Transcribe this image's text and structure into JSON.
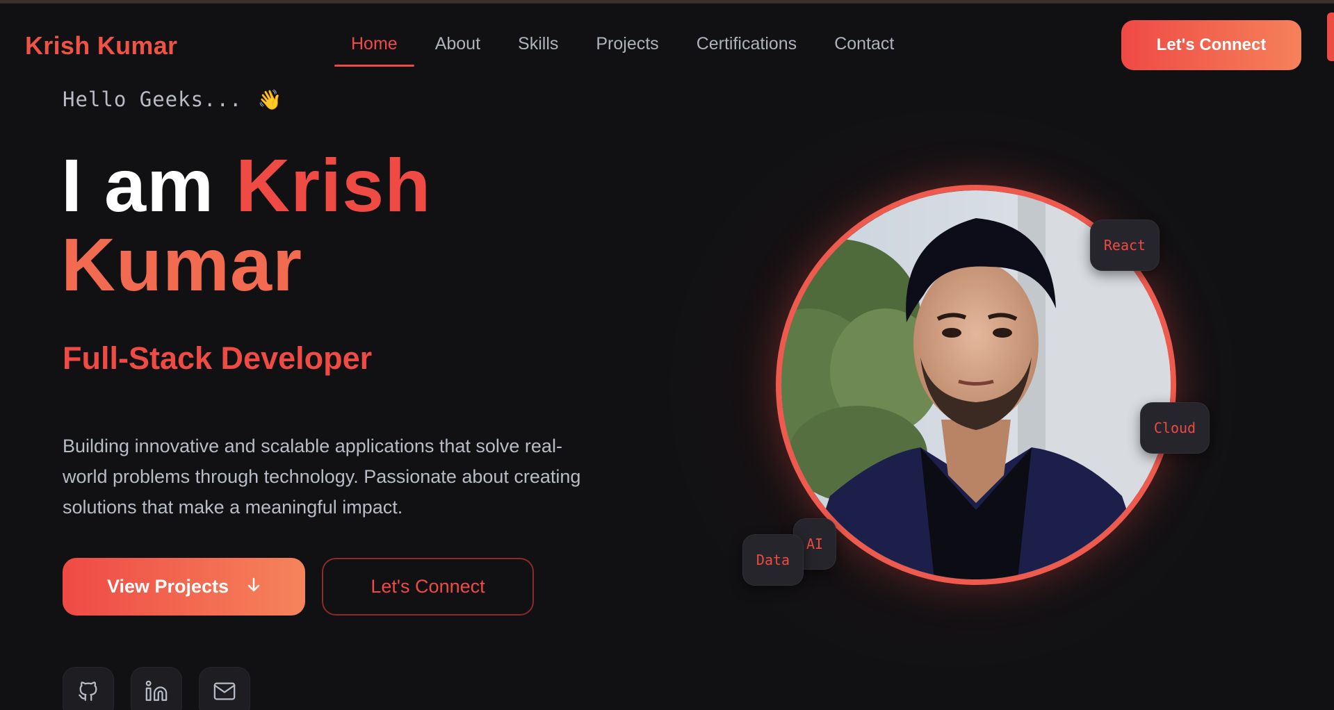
{
  "nav": {
    "brand": "Krish Kumar",
    "items": [
      {
        "label": "Home",
        "active": true
      },
      {
        "label": "About"
      },
      {
        "label": "Skills"
      },
      {
        "label": "Projects"
      },
      {
        "label": "Certifications"
      },
      {
        "label": "Contact"
      }
    ],
    "cta_label": "Let's Connect"
  },
  "hero": {
    "greeting": "Hello Geeks...",
    "greeting_icon": "waving-hand-icon",
    "headline_prefix": "I am",
    "headline_first_name": "Krish",
    "headline_last_name": "Kumar",
    "role": "Full-Stack Developer",
    "bio": "Building innovative and scalable applications that solve real-world problems through technology. Passionate about creating solutions that make a meaningful impact.",
    "primary_button": "View Projects",
    "primary_button_icon": "arrow-down-icon",
    "secondary_button": "Let's Connect",
    "socials": [
      {
        "icon": "github-icon"
      },
      {
        "icon": "linkedin-icon"
      },
      {
        "icon": "mail-icon"
      }
    ]
  },
  "portrait": {
    "chips": [
      "React",
      "Cloud",
      "AI",
      "Data"
    ]
  },
  "colors": {
    "background": "#111114",
    "accent": "#ef4a44",
    "accent_gradient_end": "#f5815a",
    "muted_text": "#b8bcc7"
  }
}
